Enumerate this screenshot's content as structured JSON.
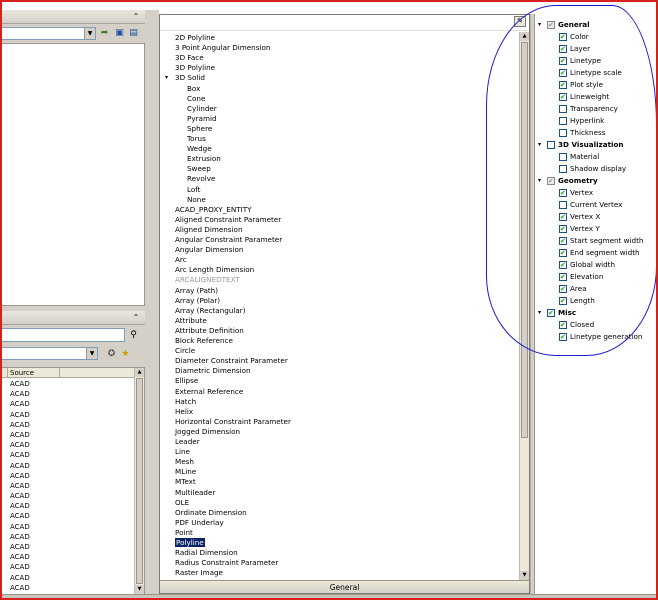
{
  "left_panel": {
    "list_header": "Source",
    "rows": [
      "ACAD",
      "ACAD",
      "ACAD",
      "ACAD",
      "ACAD",
      "ACAD",
      "ACAD",
      "ACAD",
      "ACAD",
      "ACAD",
      "ACAD",
      "ACAD",
      "ACAD",
      "ACAD",
      "ACAD",
      "ACAD",
      "ACAD",
      "ACAD",
      "ACAD",
      "ACAD",
      "ACAD",
      "ACAD"
    ]
  },
  "object_list": {
    "footer": "General",
    "selected": "Polyline",
    "items": [
      {
        "label": "2D Polyline",
        "indent": 0
      },
      {
        "label": "3 Point Angular Dimension",
        "indent": 0
      },
      {
        "label": "3D Face",
        "indent": 0
      },
      {
        "label": "3D Polyline",
        "indent": 0
      },
      {
        "label": "3D Solid",
        "indent": 0,
        "expanded": true
      },
      {
        "label": "Box",
        "indent": 1
      },
      {
        "label": "Cone",
        "indent": 1
      },
      {
        "label": "Cylinder",
        "indent": 1
      },
      {
        "label": "Pyramid",
        "indent": 1
      },
      {
        "label": "Sphere",
        "indent": 1
      },
      {
        "label": "Torus",
        "indent": 1
      },
      {
        "label": "Wedge",
        "indent": 1
      },
      {
        "label": "Extrusion",
        "indent": 1
      },
      {
        "label": "Sweep",
        "indent": 1
      },
      {
        "label": "Revolve",
        "indent": 1
      },
      {
        "label": "Loft",
        "indent": 1
      },
      {
        "label": "None",
        "indent": 1
      },
      {
        "label": "ACAD_PROXY_ENTITY",
        "indent": 0
      },
      {
        "label": "Aligned Constraint Parameter",
        "indent": 0
      },
      {
        "label": "Aligned Dimension",
        "indent": 0
      },
      {
        "label": "Angular Constraint Parameter",
        "indent": 0
      },
      {
        "label": "Angular Dimension",
        "indent": 0
      },
      {
        "label": "Arc",
        "indent": 0
      },
      {
        "label": "Arc Length Dimension",
        "indent": 0
      },
      {
        "label": "ARCALIGNEDTEXT",
        "indent": 0,
        "grey": true
      },
      {
        "label": "Array (Path)",
        "indent": 0
      },
      {
        "label": "Array (Polar)",
        "indent": 0
      },
      {
        "label": "Array (Rectangular)",
        "indent": 0
      },
      {
        "label": "Attribute",
        "indent": 0
      },
      {
        "label": "Attribute Definition",
        "indent": 0
      },
      {
        "label": "Block Reference",
        "indent": 0
      },
      {
        "label": "Circle",
        "indent": 0
      },
      {
        "label": "Diameter Constraint Parameter",
        "indent": 0
      },
      {
        "label": "Diametric Dimension",
        "indent": 0
      },
      {
        "label": "Ellipse",
        "indent": 0
      },
      {
        "label": "External Reference",
        "indent": 0
      },
      {
        "label": "Hatch",
        "indent": 0
      },
      {
        "label": "Helix",
        "indent": 0
      },
      {
        "label": "Horizontal Constraint Parameter",
        "indent": 0
      },
      {
        "label": "Jogged Dimension",
        "indent": 0
      },
      {
        "label": "Leader",
        "indent": 0
      },
      {
        "label": "Line",
        "indent": 0
      },
      {
        "label": "Mesh",
        "indent": 0
      },
      {
        "label": "MLine",
        "indent": 0
      },
      {
        "label": "MText",
        "indent": 0
      },
      {
        "label": "Multileader",
        "indent": 0
      },
      {
        "label": "OLE",
        "indent": 0
      },
      {
        "label": "Ordinate Dimension",
        "indent": 0
      },
      {
        "label": "PDF Underlay",
        "indent": 0
      },
      {
        "label": "Point",
        "indent": 0
      },
      {
        "label": "Polyline",
        "indent": 0,
        "selected": true
      },
      {
        "label": "Radial Dimension",
        "indent": 0
      },
      {
        "label": "Radius Constraint Parameter",
        "indent": 0
      },
      {
        "label": "Raster Image",
        "indent": 0
      }
    ]
  },
  "properties": [
    {
      "label": "General",
      "group": true,
      "state": "partial"
    },
    {
      "label": "Color",
      "state": "on"
    },
    {
      "label": "Layer",
      "state": "on"
    },
    {
      "label": "Linetype",
      "state": "on"
    },
    {
      "label": "Linetype scale",
      "state": "on"
    },
    {
      "label": "Plot style",
      "state": "on"
    },
    {
      "label": "Lineweight",
      "state": "on"
    },
    {
      "label": "Transparency",
      "state": "off"
    },
    {
      "label": "Hyperlink",
      "state": "off"
    },
    {
      "label": "Thickness",
      "state": "off"
    },
    {
      "label": "3D Visualization",
      "group": true,
      "state": "off"
    },
    {
      "label": "Material",
      "state": "off"
    },
    {
      "label": "Shadow display",
      "state": "off"
    },
    {
      "label": "Geometry",
      "group": true,
      "state": "partial"
    },
    {
      "label": "Vertex",
      "state": "on"
    },
    {
      "label": "Current Vertex",
      "state": "off"
    },
    {
      "label": "Vertex X",
      "state": "on"
    },
    {
      "label": "Vertex Y",
      "state": "on"
    },
    {
      "label": "Start segment width",
      "state": "on"
    },
    {
      "label": "End segment width",
      "state": "on"
    },
    {
      "label": "Global width",
      "state": "on"
    },
    {
      "label": "Elevation",
      "state": "on"
    },
    {
      "label": "Area",
      "state": "on"
    },
    {
      "label": "Length",
      "state": "on"
    },
    {
      "label": "Misc",
      "group": true,
      "state": "on"
    },
    {
      "label": "Closed",
      "state": "on"
    },
    {
      "label": "Linetype generation",
      "state": "on"
    }
  ],
  "colors": {
    "selection": "#0a246a",
    "annotation": "#1a1ad6",
    "frame": "#d6211f",
    "check": "#21a121"
  }
}
